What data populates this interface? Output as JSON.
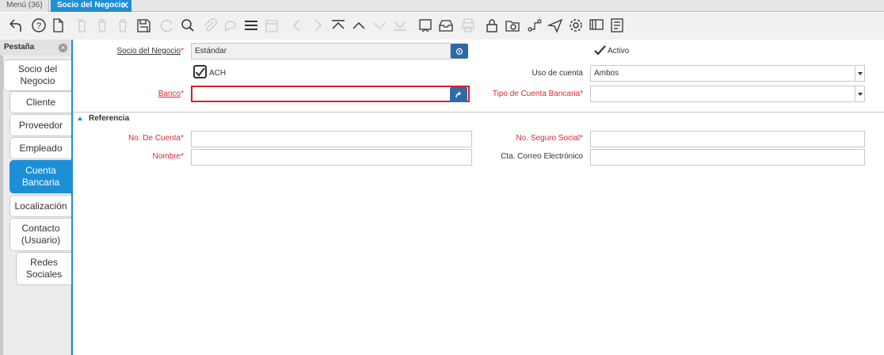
{
  "window_tabs": {
    "menu": "Menú (36)",
    "active": "Socio del Negocio"
  },
  "toolbar": {
    "icons": [
      "undo-icon",
      "help-icon",
      "new-record-icon",
      "copy-icon",
      "delete-icon",
      "delete-selection-icon",
      "save-icon",
      "refresh-icon",
      "find-icon",
      "attachment-icon",
      "chat-icon",
      "grid-toggle-icon",
      "calendar-icon",
      "previous-icon",
      "next-icon",
      "first-record-icon",
      "parent-record-icon",
      "detail-record-icon",
      "last-record-icon",
      "report-icon",
      "archive-icon",
      "print-icon",
      "lock-icon",
      "zoom-across-icon",
      "workflow-icon",
      "send-icon",
      "settings-icon",
      "process-icon",
      "form-icon"
    ]
  },
  "sidebar": {
    "title": "Pestaña",
    "tabs": [
      {
        "label_1": "Socio del",
        "label_2": "Negocio"
      },
      {
        "label_1": "Cliente",
        "label_2": ""
      },
      {
        "label_1": "Proveedor",
        "label_2": ""
      },
      {
        "label_1": "Empleado",
        "label_2": ""
      },
      {
        "label_1": "Cuenta",
        "label_2": "Bancaria"
      },
      {
        "label_1": "Localización",
        "label_2": ""
      },
      {
        "label_1": "Contacto",
        "label_2": "(Usuario)"
      },
      {
        "label_1": "Redes",
        "label_2": "Sociales"
      }
    ],
    "active_index": 4
  },
  "form": {
    "socio": {
      "label": "Socio del Negocio",
      "value": "Estándar"
    },
    "activo": {
      "label": "Activo",
      "checked": true
    },
    "ach": {
      "label": "ACH",
      "checked": true
    },
    "uso_cuenta": {
      "label": "Uso de cuenta",
      "value": "Ambos"
    },
    "banco": {
      "label": "Banco",
      "value": ""
    },
    "tipo_cuenta": {
      "label": "Tipo de Cuenta Bancaria",
      "value": ""
    },
    "section": "Referencia",
    "no_cuenta": {
      "label": "No. De Cuenta",
      "value": ""
    },
    "no_seguro": {
      "label": "No. Seguro Social",
      "value": ""
    },
    "nombre": {
      "label": "Nombre",
      "value": ""
    },
    "correo": {
      "label": "Cta. Correo Electrónico",
      "value": ""
    }
  },
  "colors": {
    "accent": "#1d8fd6",
    "error": "#d6202a",
    "button": "#2f6aa8"
  }
}
